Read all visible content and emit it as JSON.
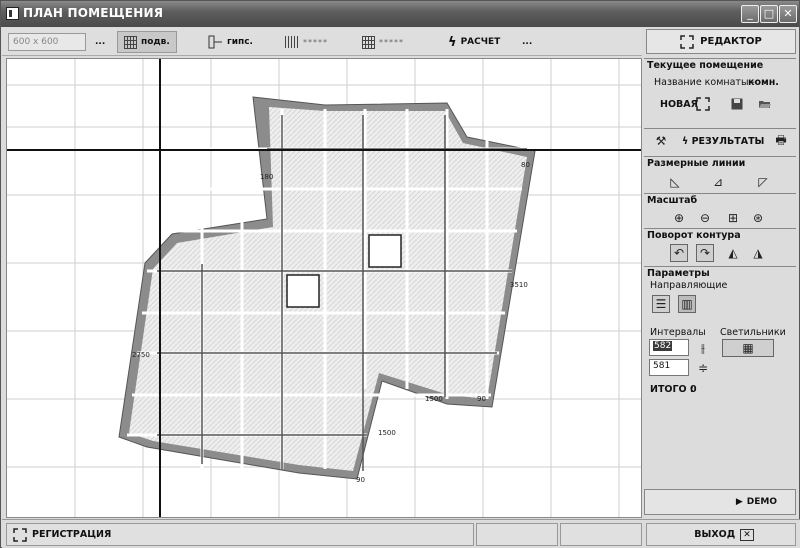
{
  "window": {
    "title": "ПЛАН ПОМЕЩЕНИЯ"
  },
  "toolbar": {
    "tile_size": "600 x 600",
    "more1": "...",
    "subfloor_label": "подв.",
    "drywall_label": "гипс.",
    "guides1_label": "*****",
    "guides2_label": "*****",
    "calc_label": "РАСЧЕТ",
    "more2": "..."
  },
  "editor_label": "РЕДАКТОР",
  "panel": {
    "current_room_title": "Текущее помещение",
    "room_name_label": "Название комнаты -",
    "room_name_value": "комн.",
    "new_label": "НОВАЯ",
    "results_label": "РЕЗУЛЬТАТЫ",
    "dim_lines_title": "Размерные линии",
    "scale_title": "Масштаб",
    "rotate_title": "Поворот контура",
    "params_title": "Параметры",
    "guides_label": "Направляющие",
    "intervals_label": "Интервалы",
    "lights_label": "Светильники",
    "interval_1": "582",
    "interval_2": "581",
    "total_label": "ИТОГО :",
    "total_value": "0"
  },
  "demo_label": "DEMO",
  "status": {
    "register_label": "РЕГИСТРАЦИЯ",
    "exit_label": "ВЫХОД"
  },
  "drawing": {
    "dims": [
      "180",
      "80",
      "3510",
      "1500",
      "90",
      "1500",
      "90",
      "2750"
    ]
  },
  "colors": {
    "wall": "#8a8a8a",
    "tile": "#ececec",
    "grid": "#cfcfcf"
  }
}
